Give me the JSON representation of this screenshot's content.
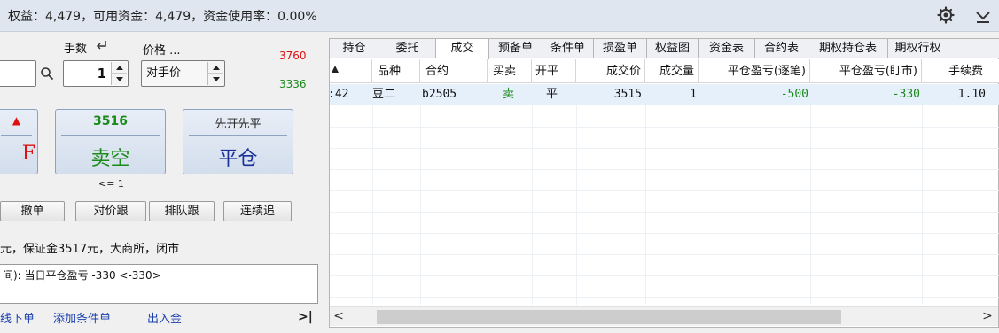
{
  "topbar": {
    "summary": "权益：4,479，可用资金：4,479，资金使用率：0.00%",
    "settings_icon": "gear-icon",
    "collapse_icon": "chevron-down-icon"
  },
  "order_panel": {
    "qty_label": "手数",
    "price_label": "价格 ...",
    "limit_up": "3760",
    "limit_down": "3336",
    "quantity": "1",
    "price_type": "对手价",
    "buy_button": {
      "top": "▲",
      "main": "F"
    },
    "sell_button": {
      "price": "3516",
      "label": "卖空"
    },
    "close_button": {
      "top": "先开先平",
      "label": "平仓"
    },
    "limit_note": "<= 1",
    "actions": [
      "撤单",
      "对价跟",
      "排队跟",
      "连续追"
    ],
    "info_line": "元，保证金3517元，大商所，闭市",
    "message": "间): 当日平仓盈亏 -330  <-330>",
    "links": [
      "线下单",
      "添加条件单",
      "出入金"
    ],
    "expand_label": ">|"
  },
  "trades": {
    "tabs": [
      "持仓",
      "委托",
      "成交",
      "预备单",
      "条件单",
      "损盈单",
      "权益图",
      "资金表",
      "合约表",
      "期权持仓表",
      "期权行权"
    ],
    "active_tab": "成交",
    "columns": [
      "",
      "品种",
      "合约",
      "买卖",
      "开平",
      "成交价",
      "成交量",
      "平仓盈亏(逐笔)",
      "平仓盈亏(盯市)",
      "手续费"
    ],
    "rows": [
      {
        "time": ":42",
        "product": "豆二",
        "contract": "b2505",
        "side": "卖",
        "open_close": "平",
        "price": "3515",
        "volume": "1",
        "pnl_trade": "-500",
        "pnl_mtm": "-330",
        "fee": "1.10"
      }
    ]
  },
  "colors": {
    "up": "#dd1111",
    "down": "#1a8a1a",
    "link": "#1a3fae",
    "selected_row": "#e6f0fb"
  }
}
